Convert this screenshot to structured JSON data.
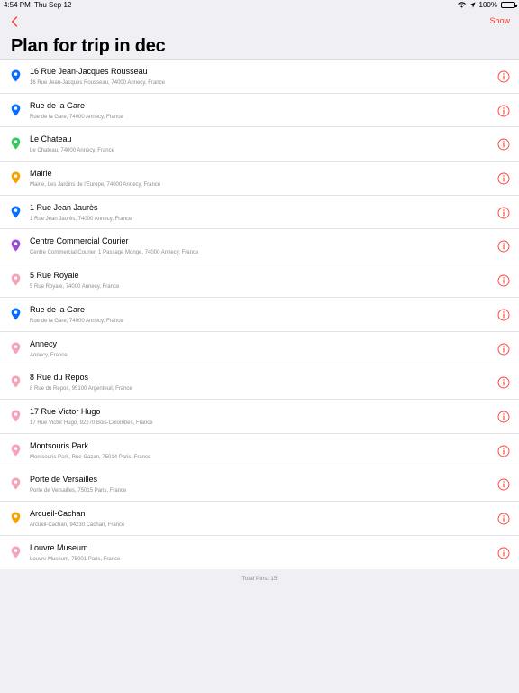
{
  "status_bar": {
    "time": "4:54 PM",
    "date": "Thu Sep 12",
    "battery": "100%"
  },
  "nav": {
    "show_label": "Show"
  },
  "page": {
    "title": "Plan for trip in dec"
  },
  "colors": {
    "accent": "#ff3b30",
    "blue": "#0a6cff",
    "green": "#34c759",
    "orange": "#f5a300",
    "purple": "#9b4dd1",
    "pink": "#f4a3b8"
  },
  "pins": [
    {
      "title": "16 Rue Jean-Jacques Rousseau",
      "subtitle": "16 Rue Jean-Jacques Rousseau, 74000 Annecy, France",
      "color": "#0a6cff"
    },
    {
      "title": "Rue de la Gare",
      "subtitle": "Rue de la Gare, 74000 Annecy, France",
      "color": "#0a6cff"
    },
    {
      "title": "Le Chateau",
      "subtitle": "Le Chateau, 74000 Annecy, France",
      "color": "#34c759"
    },
    {
      "title": "Mairie",
      "subtitle": "Mairie, Les Jardins de l'Europe, 74000 Annecy, France",
      "color": "#f5a300"
    },
    {
      "title": "1 Rue Jean Jaurès",
      "subtitle": "1 Rue Jean Jaurès, 74000 Annecy, France",
      "color": "#0a6cff"
    },
    {
      "title": "Centre Commercial Courier",
      "subtitle": "Centre Commercial Courier, 1 Passage Monge, 74000 Annecy, France",
      "color": "#9b4dd1"
    },
    {
      "title": "5 Rue Royale",
      "subtitle": "5 Rue Royale, 74000 Annecy, France",
      "color": "#f4a3b8"
    },
    {
      "title": "Rue de la Gare",
      "subtitle": "Rue de la Gare, 74000 Annecy, France",
      "color": "#0a6cff"
    },
    {
      "title": "Annecy",
      "subtitle": "Annecy, France",
      "color": "#f4a3b8"
    },
    {
      "title": "8 Rue du Repos",
      "subtitle": "8 Rue du Repos, 95100 Argenteuil, France",
      "color": "#f4a3b8"
    },
    {
      "title": "17 Rue Victor Hugo",
      "subtitle": "17 Rue Victor Hugo, 92270 Bois-Colombes, France",
      "color": "#f4a3b8"
    },
    {
      "title": "Montsouris Park",
      "subtitle": "Montsouris Park, Rue Gazan, 75014 Paris, France",
      "color": "#f4a3b8"
    },
    {
      "title": "Porte de Versailles",
      "subtitle": "Porte de Versailles, 75015 Paris, France",
      "color": "#f4a3b8"
    },
    {
      "title": "Arcueil-Cachan",
      "subtitle": "Arcueil-Cachan, 94230 Cachan, France",
      "color": "#f5a300"
    },
    {
      "title": "Louvre Museum",
      "subtitle": "Louvre Museum, 75001 Paris, France",
      "color": "#f4a3b8"
    }
  ],
  "footer": {
    "total_label": "Total Pins: 15"
  }
}
